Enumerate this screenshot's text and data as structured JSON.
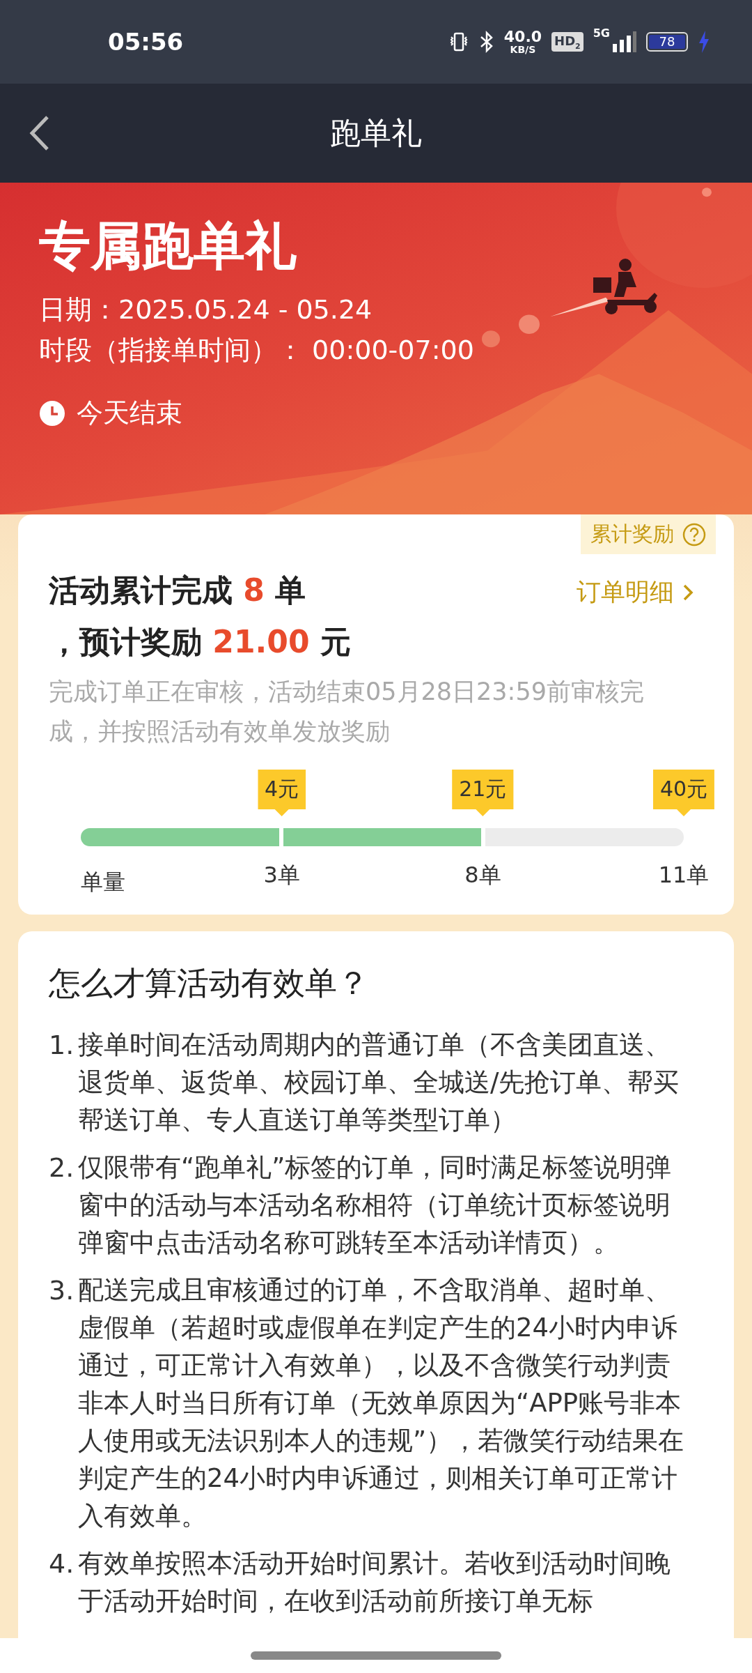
{
  "status_bar": {
    "time": "05:56",
    "speed_value": "40.0",
    "speed_unit": "KB/S",
    "hd": "HD",
    "hd_sub": "2",
    "network": "5G",
    "battery": "78",
    "charging": true
  },
  "nav": {
    "title": "跑单礼"
  },
  "banner": {
    "title": "专属跑单礼",
    "date": "日期：2025.05.24 - 05.24",
    "period": "时段（指接单时间）： 00:00-07:00",
    "countdown": "今天结束"
  },
  "progress_card": {
    "tag": "累计奖励",
    "detail_link": "订单明细",
    "summary": {
      "count_prefix": "活动累计完成",
      "count": "8",
      "count_unit": "单",
      "reward_prefix": "，预计奖励",
      "reward": "21.00",
      "reward_unit": "元"
    },
    "note": "完成订单正在审核，活动结束05月28日23:59前审核完成，并按照活动有效单发放奖励",
    "axis_label": "单量",
    "milestones": [
      {
        "reward": "4元",
        "orders": "3单",
        "reached": true
      },
      {
        "reward": "21元",
        "orders": "8单",
        "reached": true
      },
      {
        "reward": "40元",
        "orders": "11单",
        "reached": false
      }
    ]
  },
  "rules_card": {
    "title": "怎么才算活动有效单？",
    "items": [
      {
        "number": "1.",
        "text": "接单时间在活动周期内的普通订单（不含美团直送、退货单、返货单、校园订单、全城送/先抢订单、帮买帮送订单、专人直送订单等类型订单）"
      },
      {
        "number": "2.",
        "text": "仅限带有“跑单礼”标签的订单，同时满足标签说明弹窗中的活动与本活动名称相符（订单统计页标签说明弹窗中点击活动名称可跳转至本活动详情页）。"
      },
      {
        "number": "3.",
        "text": "配送完成且审核通过的订单，不含取消单、超时单、虚假单（若超时或虚假单在判定产生的24小时内申诉通过，可正常计入有效单），以及不含微笑行动判责非本人时当日所有订单（无效单原因为“APP账号非本人使用或无法识别本人的违规”），若微笑行动结果在判定产生的24小时内申诉通过，则相关订单可正常计入有效单。"
      },
      {
        "number": "4.",
        "text": "有效单按照本活动开始时间累计。若收到活动时间晚于活动开始时间，在收到活动前所接订单无标"
      }
    ]
  }
}
